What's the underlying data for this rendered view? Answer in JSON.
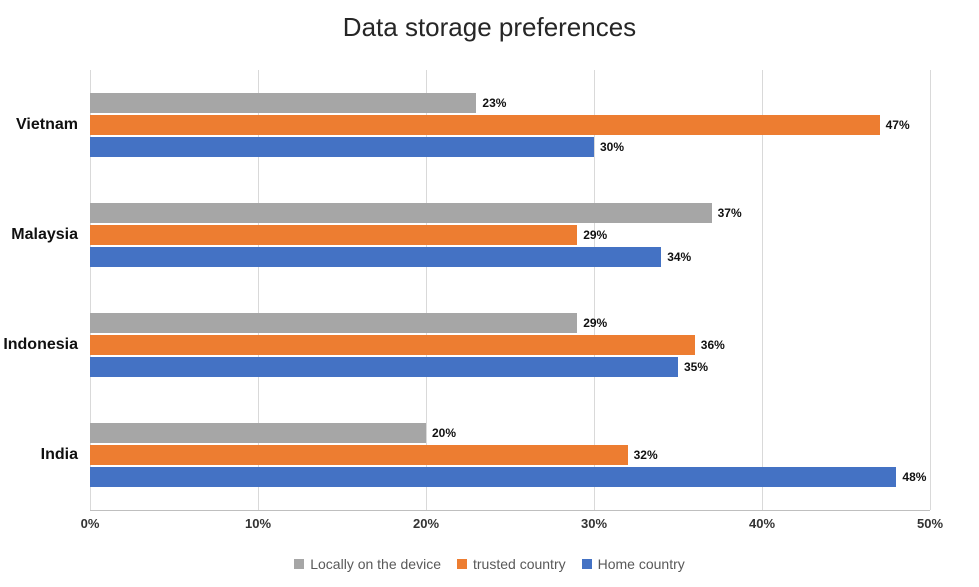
{
  "chart_data": {
    "type": "bar",
    "orientation": "horizontal",
    "title": "Data storage preferences",
    "xlabel": "",
    "ylabel": "",
    "xlim": [
      0,
      50
    ],
    "x_ticks": [
      0,
      10,
      20,
      30,
      40,
      50
    ],
    "x_tick_labels": [
      "0%",
      "10%",
      "20%",
      "30%",
      "40%",
      "50%"
    ],
    "categories": [
      "Vietnam",
      "Malaysia",
      "Indonesia",
      "India"
    ],
    "series": [
      {
        "name": "Locally on the device",
        "color": "#a6a6a6",
        "values": [
          23,
          37,
          29,
          20
        ]
      },
      {
        "name": "trusted country",
        "color": "#ed7d31",
        "values": [
          47,
          29,
          36,
          32
        ]
      },
      {
        "name": "Home country",
        "color": "#4472c4",
        "values": [
          30,
          34,
          35,
          48
        ]
      }
    ],
    "value_suffix": "%",
    "legend_position": "bottom"
  }
}
